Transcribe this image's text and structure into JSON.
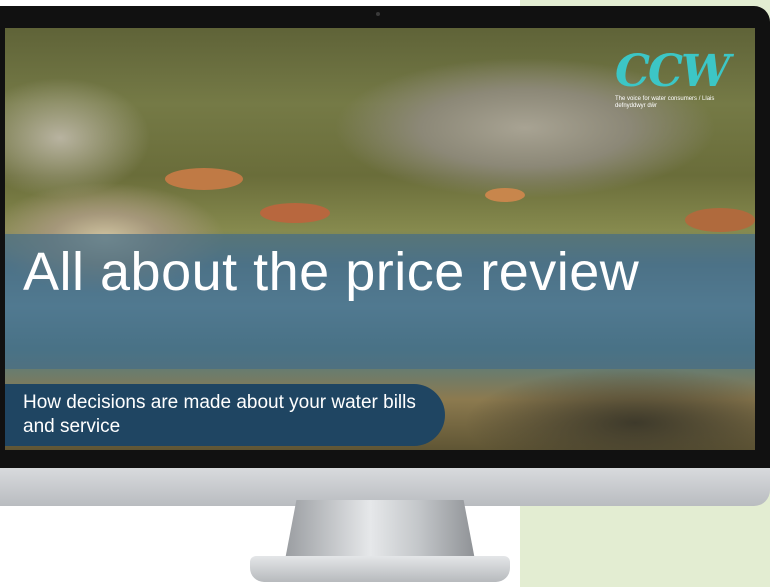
{
  "slide": {
    "title": "All about the price review",
    "subtitle": "How decisions are made about your water bills and service"
  },
  "logo": {
    "text": "CCW",
    "tagline": "The voice for water consumers / Llais defnyddwyr dŵr"
  },
  "colors": {
    "logo_teal": "#3cc6c6",
    "subtitle_pill": "#1f4562",
    "title_band": "#466e87",
    "background_panel": "#e3edd2"
  },
  "icons": [
    "ccw-logo-icon"
  ]
}
